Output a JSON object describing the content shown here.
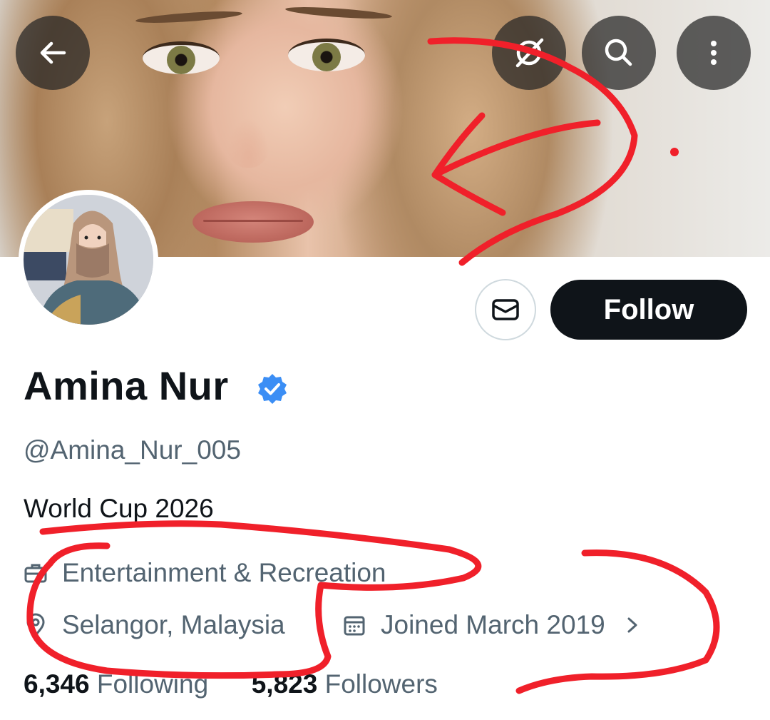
{
  "header": {
    "back_icon": "arrow-left-icon",
    "grok_icon": "grok-icon",
    "search_icon": "search-icon",
    "more_icon": "more-vertical-icon"
  },
  "profile": {
    "display_name": "Amina Nur",
    "verified": true,
    "verified_color": "#3b8ef5",
    "handle": "@Amina_Nur_005",
    "bio": "World Cup 2026",
    "category": "Entertainment & Recreation",
    "location": "Selangor, Malaysia",
    "joined": "Joined March 2019",
    "following_count": "6,346",
    "following_label": "Following",
    "followers_count": "5,823",
    "followers_label": "Followers"
  },
  "actions": {
    "message_icon": "envelope-icon",
    "follow_label": "Follow"
  },
  "colors": {
    "text_primary": "#0f1419",
    "text_secondary": "#536471",
    "follow_bg": "#0f1419",
    "annotation_red": "#f0202a"
  }
}
